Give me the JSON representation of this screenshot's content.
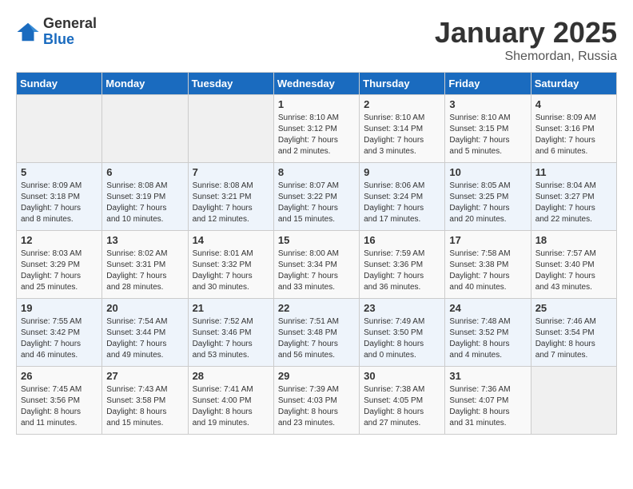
{
  "logo": {
    "general": "General",
    "blue": "Blue"
  },
  "title": "January 2025",
  "subtitle": "Shemordan, Russia",
  "days_header": [
    "Sunday",
    "Monday",
    "Tuesday",
    "Wednesday",
    "Thursday",
    "Friday",
    "Saturday"
  ],
  "weeks": [
    [
      {
        "day": "",
        "info": ""
      },
      {
        "day": "",
        "info": ""
      },
      {
        "day": "",
        "info": ""
      },
      {
        "day": "1",
        "info": "Sunrise: 8:10 AM\nSunset: 3:12 PM\nDaylight: 7 hours\nand 2 minutes."
      },
      {
        "day": "2",
        "info": "Sunrise: 8:10 AM\nSunset: 3:14 PM\nDaylight: 7 hours\nand 3 minutes."
      },
      {
        "day": "3",
        "info": "Sunrise: 8:10 AM\nSunset: 3:15 PM\nDaylight: 7 hours\nand 5 minutes."
      },
      {
        "day": "4",
        "info": "Sunrise: 8:09 AM\nSunset: 3:16 PM\nDaylight: 7 hours\nand 6 minutes."
      }
    ],
    [
      {
        "day": "5",
        "info": "Sunrise: 8:09 AM\nSunset: 3:18 PM\nDaylight: 7 hours\nand 8 minutes."
      },
      {
        "day": "6",
        "info": "Sunrise: 8:08 AM\nSunset: 3:19 PM\nDaylight: 7 hours\nand 10 minutes."
      },
      {
        "day": "7",
        "info": "Sunrise: 8:08 AM\nSunset: 3:21 PM\nDaylight: 7 hours\nand 12 minutes."
      },
      {
        "day": "8",
        "info": "Sunrise: 8:07 AM\nSunset: 3:22 PM\nDaylight: 7 hours\nand 15 minutes."
      },
      {
        "day": "9",
        "info": "Sunrise: 8:06 AM\nSunset: 3:24 PM\nDaylight: 7 hours\nand 17 minutes."
      },
      {
        "day": "10",
        "info": "Sunrise: 8:05 AM\nSunset: 3:25 PM\nDaylight: 7 hours\nand 20 minutes."
      },
      {
        "day": "11",
        "info": "Sunrise: 8:04 AM\nSunset: 3:27 PM\nDaylight: 7 hours\nand 22 minutes."
      }
    ],
    [
      {
        "day": "12",
        "info": "Sunrise: 8:03 AM\nSunset: 3:29 PM\nDaylight: 7 hours\nand 25 minutes."
      },
      {
        "day": "13",
        "info": "Sunrise: 8:02 AM\nSunset: 3:31 PM\nDaylight: 7 hours\nand 28 minutes."
      },
      {
        "day": "14",
        "info": "Sunrise: 8:01 AM\nSunset: 3:32 PM\nDaylight: 7 hours\nand 30 minutes."
      },
      {
        "day": "15",
        "info": "Sunrise: 8:00 AM\nSunset: 3:34 PM\nDaylight: 7 hours\nand 33 minutes."
      },
      {
        "day": "16",
        "info": "Sunrise: 7:59 AM\nSunset: 3:36 PM\nDaylight: 7 hours\nand 36 minutes."
      },
      {
        "day": "17",
        "info": "Sunrise: 7:58 AM\nSunset: 3:38 PM\nDaylight: 7 hours\nand 40 minutes."
      },
      {
        "day": "18",
        "info": "Sunrise: 7:57 AM\nSunset: 3:40 PM\nDaylight: 7 hours\nand 43 minutes."
      }
    ],
    [
      {
        "day": "19",
        "info": "Sunrise: 7:55 AM\nSunset: 3:42 PM\nDaylight: 7 hours\nand 46 minutes."
      },
      {
        "day": "20",
        "info": "Sunrise: 7:54 AM\nSunset: 3:44 PM\nDaylight: 7 hours\nand 49 minutes."
      },
      {
        "day": "21",
        "info": "Sunrise: 7:52 AM\nSunset: 3:46 PM\nDaylight: 7 hours\nand 53 minutes."
      },
      {
        "day": "22",
        "info": "Sunrise: 7:51 AM\nSunset: 3:48 PM\nDaylight: 7 hours\nand 56 minutes."
      },
      {
        "day": "23",
        "info": "Sunrise: 7:49 AM\nSunset: 3:50 PM\nDaylight: 8 hours\nand 0 minutes."
      },
      {
        "day": "24",
        "info": "Sunrise: 7:48 AM\nSunset: 3:52 PM\nDaylight: 8 hours\nand 4 minutes."
      },
      {
        "day": "25",
        "info": "Sunrise: 7:46 AM\nSunset: 3:54 PM\nDaylight: 8 hours\nand 7 minutes."
      }
    ],
    [
      {
        "day": "26",
        "info": "Sunrise: 7:45 AM\nSunset: 3:56 PM\nDaylight: 8 hours\nand 11 minutes."
      },
      {
        "day": "27",
        "info": "Sunrise: 7:43 AM\nSunset: 3:58 PM\nDaylight: 8 hours\nand 15 minutes."
      },
      {
        "day": "28",
        "info": "Sunrise: 7:41 AM\nSunset: 4:00 PM\nDaylight: 8 hours\nand 19 minutes."
      },
      {
        "day": "29",
        "info": "Sunrise: 7:39 AM\nSunset: 4:03 PM\nDaylight: 8 hours\nand 23 minutes."
      },
      {
        "day": "30",
        "info": "Sunrise: 7:38 AM\nSunset: 4:05 PM\nDaylight: 8 hours\nand 27 minutes."
      },
      {
        "day": "31",
        "info": "Sunrise: 7:36 AM\nSunset: 4:07 PM\nDaylight: 8 hours\nand 31 minutes."
      },
      {
        "day": "",
        "info": ""
      }
    ]
  ]
}
